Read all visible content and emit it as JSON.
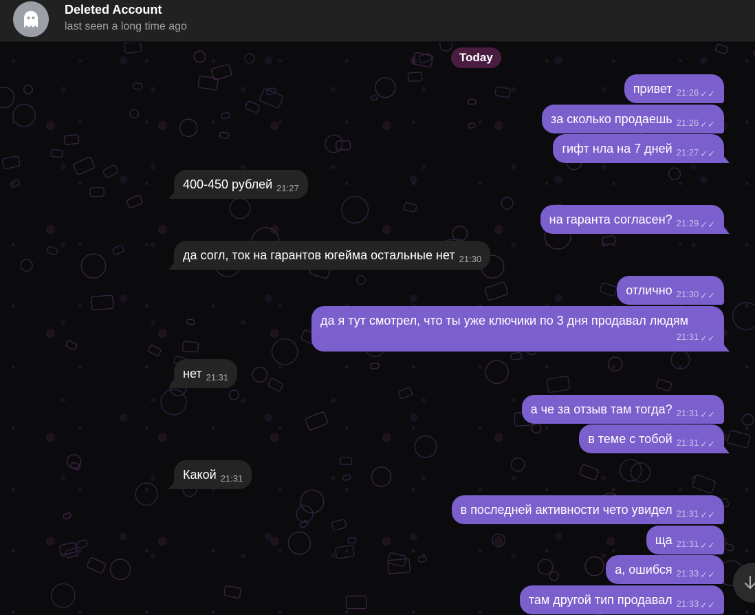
{
  "header": {
    "title": "Deleted Account",
    "status": "last seen a long time ago",
    "avatar_icon": "ghost-icon"
  },
  "chat": {
    "date_label": "Today",
    "messages": [
      {
        "dir": "out",
        "text": "привет",
        "time": "21:26"
      },
      {
        "dir": "out",
        "text": "за сколько продаешь",
        "time": "21:26"
      },
      {
        "dir": "out",
        "text": "гифт нла на 7 дней",
        "time": "21:27"
      },
      {
        "dir": "in",
        "text": "400-450 рублей",
        "time": "21:27"
      },
      {
        "dir": "out",
        "text": "на гаранта согласен?",
        "time": "21:29"
      },
      {
        "dir": "in",
        "text": "да согл, ток на гарантов югейма остальные нет",
        "time": "21:30"
      },
      {
        "dir": "out",
        "text": "отлично",
        "time": "21:30"
      },
      {
        "dir": "out",
        "text": "да я тут смотрел, что ты уже ключики по 3 дня продавал людям",
        "time": "21:31"
      },
      {
        "dir": "in",
        "text": "нет",
        "time": "21:31"
      },
      {
        "dir": "out",
        "text": "а че за отзыв там тогда?",
        "time": "21:31"
      },
      {
        "dir": "out",
        "text": "в теме с тобой",
        "time": "21:31"
      },
      {
        "dir": "in",
        "text": "Какой",
        "time": "21:31"
      },
      {
        "dir": "out",
        "text": "в последней активности чето увидел",
        "time": "21:31"
      },
      {
        "dir": "out",
        "text": "ща",
        "time": "21:31"
      },
      {
        "dir": "out",
        "text": "а, ошибся",
        "time": "21:33"
      },
      {
        "dir": "out",
        "text": "там другой тип продавал",
        "time": "21:33"
      }
    ]
  },
  "colors": {
    "outgoing_bubble": "#7a5fcd",
    "incoming_bubble": "#242424",
    "date_pill": "#4a1d40",
    "header_bg": "#212121"
  },
  "scroll_button_icon": "arrow-down-icon"
}
